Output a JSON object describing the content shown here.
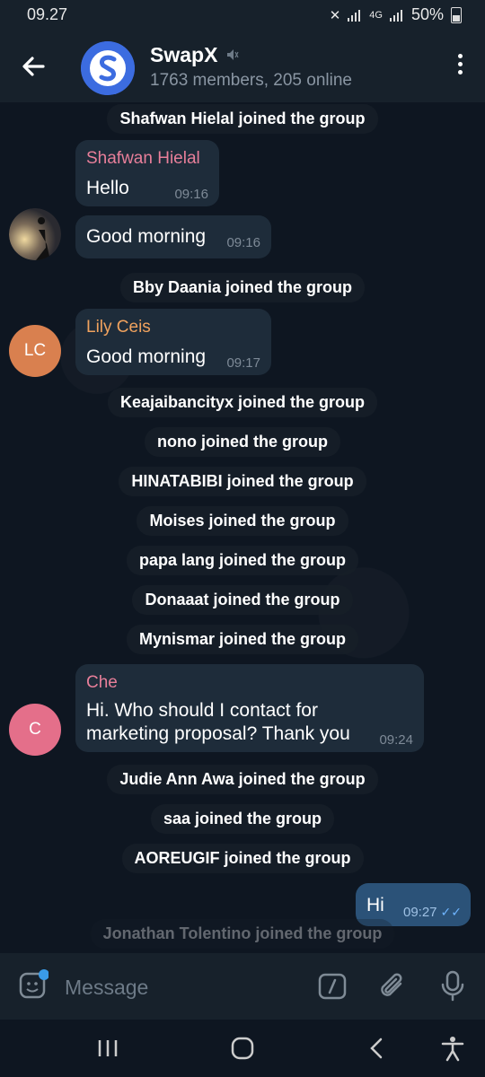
{
  "status_bar": {
    "time": "09.27",
    "network": "4G",
    "battery": "50%"
  },
  "header": {
    "title": "SwapX",
    "subtitle": "1763 members, 205 online"
  },
  "messages": {
    "svc1": "Shafwan Hielal joined the group",
    "m1": {
      "sender": "Shafwan Hielal",
      "text": "Hello",
      "time": "09:16",
      "sender_color": "#e87f9a"
    },
    "m2": {
      "text": "Good morning",
      "time": "09:16"
    },
    "svc2": "Bby Daania joined the group",
    "m3": {
      "sender": "Lily Ceis",
      "avatar": "LC",
      "text": "Good morning",
      "time": "09:17",
      "sender_color": "#f0a25e",
      "avatar_color": "#d9804f"
    },
    "svc3": "Keajaibancityx joined the group",
    "svc4": "nono joined the group",
    "svc5": "HINATABIBI joined the group",
    "svc6": "Moises joined the group",
    "svc7": "papa lang joined the group",
    "svc8": "Donaaat joined the group",
    "svc9": "Mynismar joined the group",
    "m4": {
      "sender": "Che",
      "avatar": "C",
      "text_line1": "Hi. Who should I contact for",
      "text_line2": "marketing proposal? Thank you",
      "time": "09:24",
      "sender_color": "#e87f9a",
      "avatar_color": "#e46f8a"
    },
    "svc10": "Judie Ann Awa joined the group",
    "svc11": "saa joined the group",
    "svc12": "AOREUGIF joined the group",
    "out1": {
      "text": "Hi",
      "time": "09:27"
    },
    "svc13": "Jonathan Tolentino joined the group"
  },
  "input": {
    "placeholder": "Message"
  }
}
